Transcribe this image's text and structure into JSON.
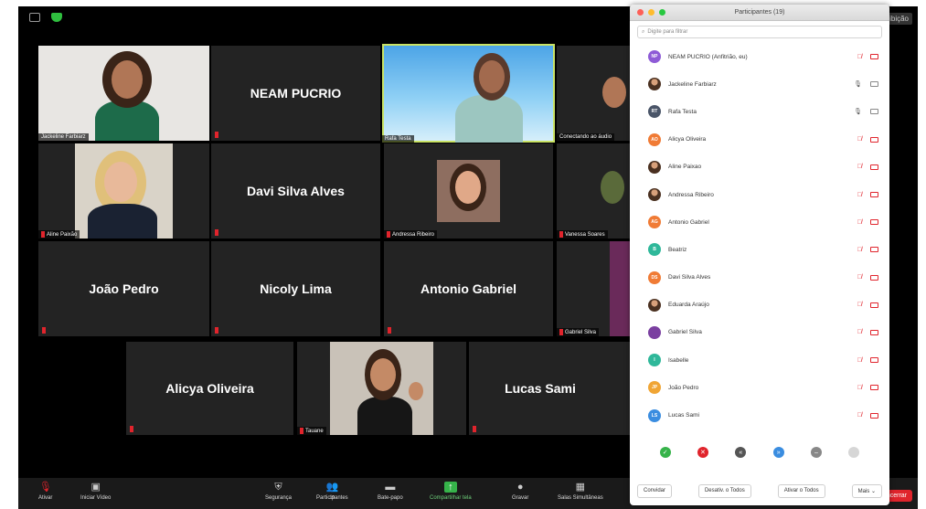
{
  "meeting": {
    "view_label": "Exibição",
    "end_label": "Encerrar"
  },
  "tiles": [
    {
      "name": "Jackeline Farbiarz",
      "type": "video"
    },
    {
      "name": "NEAM PUCRIO",
      "type": "text"
    },
    {
      "name": "Rafa Testa",
      "type": "video"
    },
    {
      "name": "Conectando ao áudio",
      "type": "video"
    },
    {
      "name": "Aline Paixão",
      "type": "video"
    },
    {
      "name": "Davi Silva Alves",
      "type": "text"
    },
    {
      "name": "Andressa Ribeiro",
      "type": "video"
    },
    {
      "name": "Vanessa Soares",
      "type": "video"
    },
    {
      "name": "João Pedro",
      "type": "text"
    },
    {
      "name": "Nicoly Lima",
      "type": "text"
    },
    {
      "name": "Antonio Gabriel",
      "type": "text"
    },
    {
      "name": "Gabriel Silva",
      "type": "video"
    },
    {
      "name": "Alicya Oliveira",
      "type": "text"
    },
    {
      "name": "Tauane",
      "type": "video"
    },
    {
      "name": "Lucas Sami",
      "type": "text"
    }
  ],
  "toolbar": {
    "mute": "Ativar",
    "video": "Iniciar Vídeo",
    "security": "Segurança",
    "participants": "Participantes",
    "participants_count": "19",
    "chat": "Bate-papo",
    "share": "Compartilhar tela",
    "record": "Gravar",
    "breakout": "Salas Simultâneas"
  },
  "participants_panel": {
    "title": "Participantes (19)",
    "search_placeholder": "Digite para filtrar",
    "items": [
      {
        "name": "NEAM PUCRIO (Anfitrião, eu)",
        "initials": "NP",
        "color": "#8e5bd6",
        "mic": "muted",
        "cam": "off"
      },
      {
        "name": "Jackeline Farbiarz",
        "initials": "",
        "color": "photo",
        "mic": "on",
        "cam": "on"
      },
      {
        "name": "Rafa Testa",
        "initials": "RT",
        "color": "#4a5568",
        "mic": "on",
        "cam": "on"
      },
      {
        "name": "Alicya Oliveira",
        "initials": "AO",
        "color": "#f07b35",
        "mic": "muted",
        "cam": "off"
      },
      {
        "name": "Aline Paixao",
        "initials": "",
        "color": "photo",
        "mic": "muted",
        "cam": "off"
      },
      {
        "name": "Andressa Ribeiro",
        "initials": "",
        "color": "photo",
        "mic": "muted",
        "cam": "off"
      },
      {
        "name": "Antonio Gabriel",
        "initials": "AG",
        "color": "#f07b35",
        "mic": "muted",
        "cam": "off"
      },
      {
        "name": "Beatriz",
        "initials": "B",
        "color": "#2fb89a",
        "mic": "muted",
        "cam": "off"
      },
      {
        "name": "Davi Silva Alves",
        "initials": "DS",
        "color": "#f07b35",
        "mic": "muted",
        "cam": "off"
      },
      {
        "name": "Eduarda Araújo",
        "initials": "",
        "color": "photo",
        "mic": "muted",
        "cam": "off"
      },
      {
        "name": "Gabriel Silva",
        "initials": "",
        "color": "#7a3fa0",
        "mic": "muted",
        "cam": "off"
      },
      {
        "name": "Isabelle",
        "initials": "I",
        "color": "#2fb89a",
        "mic": "muted",
        "cam": "off"
      },
      {
        "name": "João Pedro",
        "initials": "JP",
        "color": "#f0a535",
        "mic": "muted",
        "cam": "off"
      },
      {
        "name": "Lucas Sami",
        "initials": "LS",
        "color": "#3a8de0",
        "mic": "muted",
        "cam": "off"
      }
    ],
    "reactions": [
      {
        "label": "✓",
        "color": "#36b34a"
      },
      {
        "label": "✕",
        "color": "#e0242c"
      },
      {
        "label": "«",
        "color": "#555555"
      },
      {
        "label": "»",
        "color": "#3a8de0"
      },
      {
        "label": "–",
        "color": "#888888"
      },
      {
        "label": "",
        "color": "#d6d6d6"
      }
    ],
    "buttons": {
      "invite": "Convidar",
      "mute_all": "Desativ. o Todos",
      "unmute_all": "Ativar o Todos",
      "more": "Mais"
    }
  }
}
